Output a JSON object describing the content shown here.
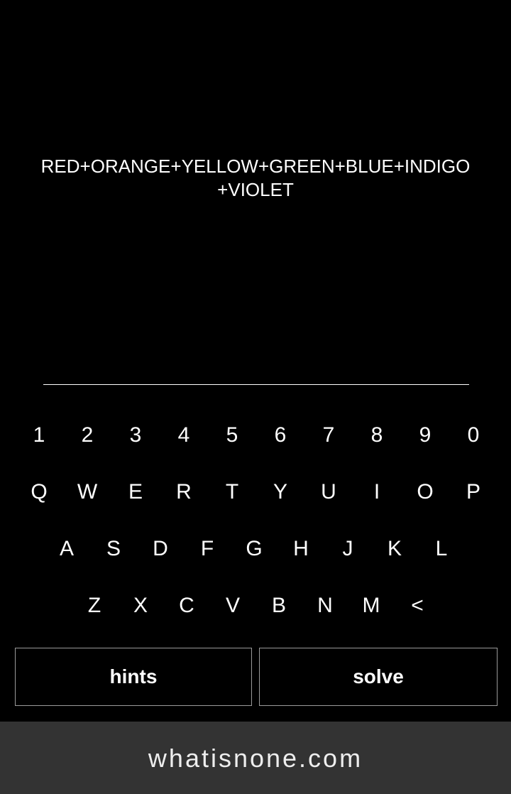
{
  "puzzle": {
    "clue_line1": "RED+ORANGE+YELLOW+GREEN+BLUE+INDIGO",
    "clue_line2": "+VIOLET"
  },
  "answer": {
    "value": ""
  },
  "keyboard": {
    "row1": [
      "1",
      "2",
      "3",
      "4",
      "5",
      "6",
      "7",
      "8",
      "9",
      "0"
    ],
    "row2": [
      "Q",
      "W",
      "E",
      "R",
      "T",
      "Y",
      "U",
      "I",
      "O",
      "P"
    ],
    "row3": [
      "A",
      "S",
      "D",
      "F",
      "G",
      "H",
      "J",
      "K",
      "L"
    ],
    "row4": [
      "Z",
      "X",
      "C",
      "V",
      "B",
      "N",
      "M",
      "<"
    ]
  },
  "buttons": {
    "hints_label": "hints",
    "solve_label": "solve"
  },
  "footer": {
    "site": "whatisnone.com"
  },
  "colors": {
    "background": "#000000",
    "text": "#ffffff",
    "footer_bg": "#333333",
    "button_border": "#9a9a9a"
  }
}
